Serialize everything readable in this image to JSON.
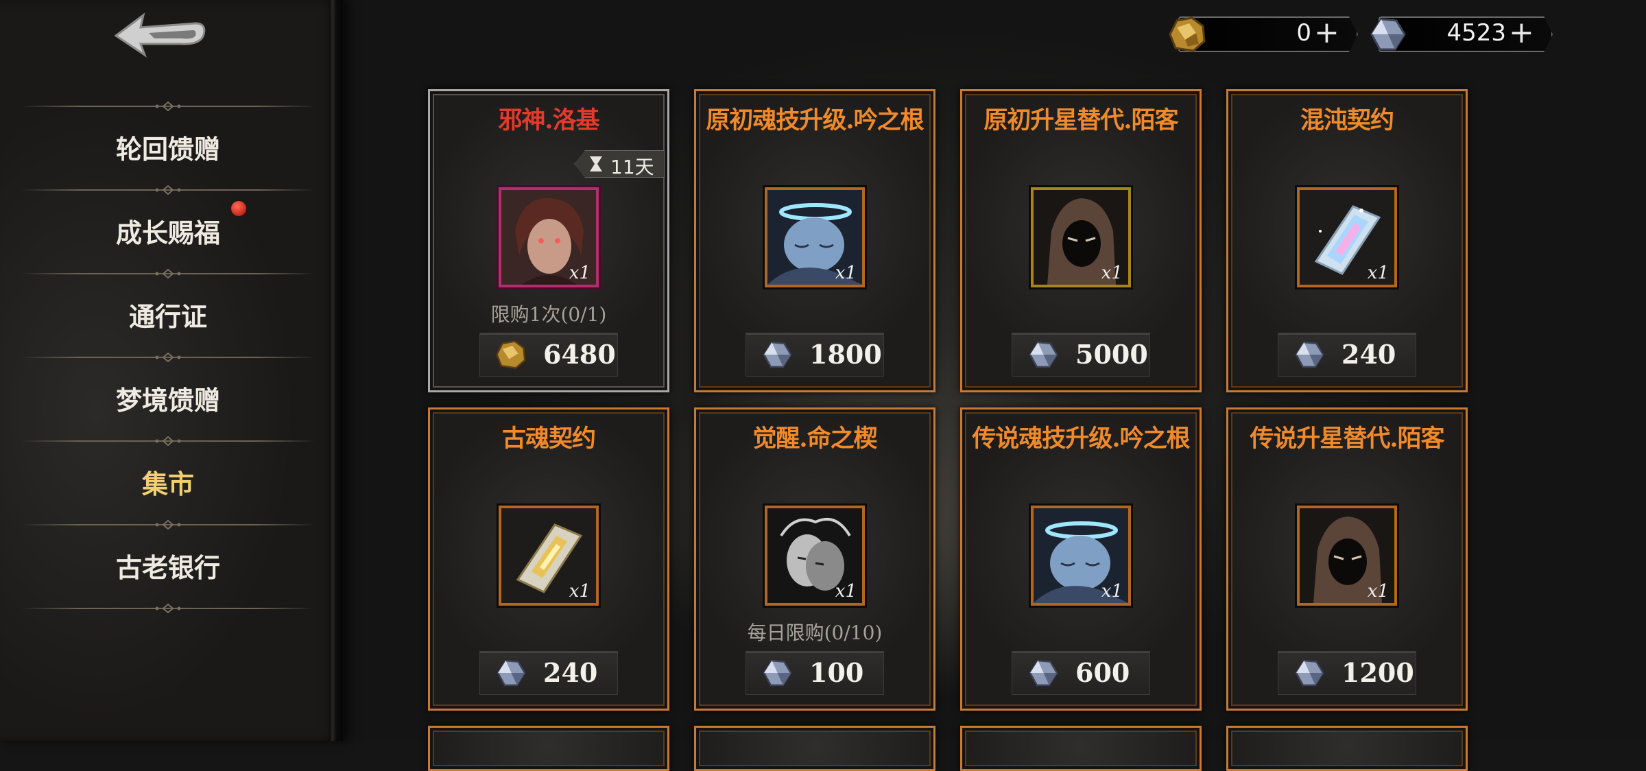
{
  "sidebar": {
    "items": [
      {
        "label": "轮回馈赠"
      },
      {
        "label": "成长赐福"
      },
      {
        "label": "通行证"
      },
      {
        "label": "梦境馈赠"
      },
      {
        "label": "集市"
      },
      {
        "label": "古老银行"
      }
    ],
    "active_index": 4
  },
  "currency": {
    "gold_value": "0",
    "gem_value": "4523",
    "plus_symbol": "+"
  },
  "cards": [
    {
      "title": "邪神.洛基",
      "qty": "x1",
      "limit": "限购1次(0/1)",
      "timer": "11天",
      "price": "6480",
      "price_currency": "gold-ore-icon"
    },
    {
      "title": "原初魂技升级.吟之根",
      "qty": "x1",
      "price": "1800",
      "price_currency": "crystal-icon"
    },
    {
      "title": "原初升星替代.陌客",
      "qty": "x1",
      "price": "5000",
      "price_currency": "crystal-icon"
    },
    {
      "title": "混沌契约",
      "qty": "x1",
      "price": "240",
      "price_currency": "crystal-icon"
    },
    {
      "title": "古魂契约",
      "qty": "x1",
      "price": "240",
      "price_currency": "crystal-icon"
    },
    {
      "title": "觉醒.命之楔",
      "qty": "x1",
      "limit": "每日限购(0/10)",
      "price": "100",
      "price_currency": "crystal-icon"
    },
    {
      "title": "传说魂技升级.吟之根",
      "qty": "x1",
      "price": "600",
      "price_currency": "crystal-icon"
    },
    {
      "title": "传说升星替代.陌客",
      "qty": "x1",
      "price": "1200",
      "price_currency": "crystal-icon"
    }
  ],
  "colors": {
    "accent_orange": "#f08a2a",
    "title_red": "#e43a2c",
    "active_nav": "#f3cf71",
    "frame_orange": "#c97a32"
  }
}
